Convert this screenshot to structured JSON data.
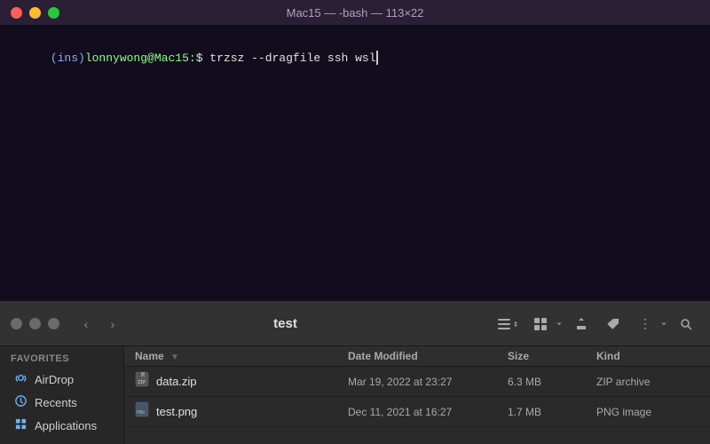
{
  "terminal": {
    "title": "Mac15 — -bash — 113×22",
    "prompt_ins": "(ins)",
    "prompt_user": "lonnywong",
    "prompt_at": "@",
    "prompt_host": "Mac15",
    "prompt_separator": ":",
    "prompt_dollar": "$ ",
    "command": "trzsz --dragfile ssh wsl"
  },
  "finder": {
    "folder_name": "test",
    "sidebar": {
      "favorites_label": "Favorites",
      "items": [
        {
          "label": "AirDrop",
          "icon": "airdrop"
        },
        {
          "label": "Recents",
          "icon": "recents"
        },
        {
          "label": "Applications",
          "icon": "applications"
        }
      ]
    },
    "table": {
      "headers": [
        {
          "label": "Name",
          "key": "name"
        },
        {
          "label": "Date Modified",
          "key": "date"
        },
        {
          "label": "Size",
          "key": "size"
        },
        {
          "label": "Kind",
          "key": "kind"
        }
      ],
      "rows": [
        {
          "name": "data.zip",
          "icon": "zip",
          "date": "Mar 19, 2022 at 23:27",
          "size": "6.3 MB",
          "kind": "ZIP archive"
        },
        {
          "name": "test.png",
          "icon": "png",
          "date": "Dec 11, 2021 at 16:27",
          "size": "1.7 MB",
          "kind": "PNG image"
        }
      ]
    }
  }
}
